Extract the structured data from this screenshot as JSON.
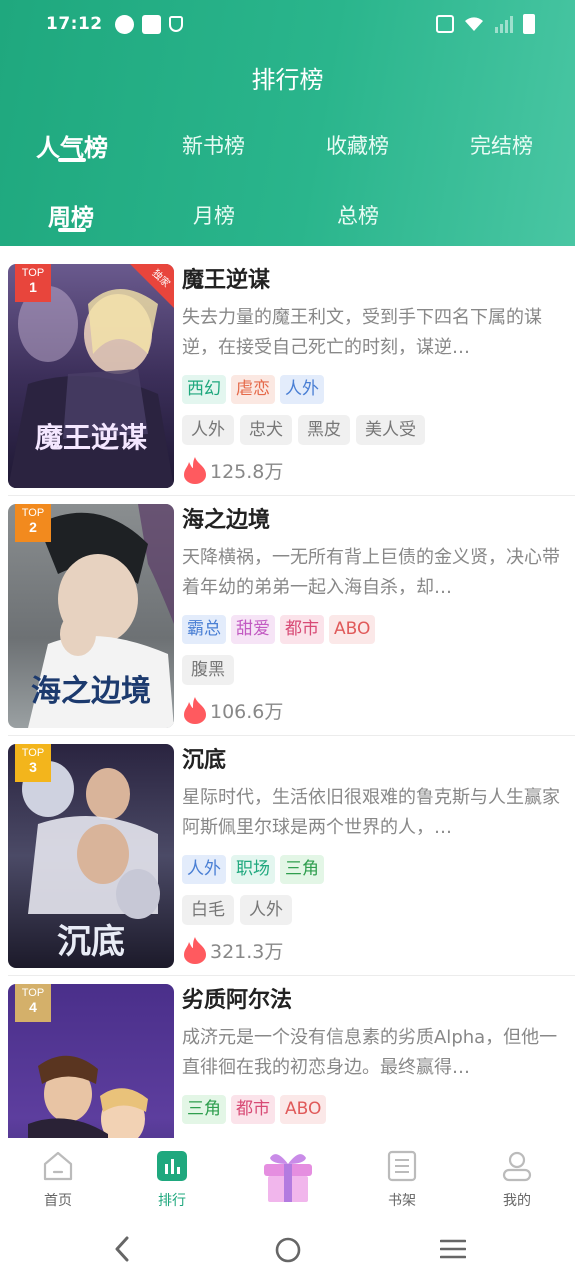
{
  "status_bar": {
    "time": "17:12"
  },
  "header": {
    "title": "排行榜",
    "tabs": [
      {
        "label": "人气榜",
        "active": true
      },
      {
        "label": "新书榜",
        "active": false
      },
      {
        "label": "收藏榜",
        "active": false
      },
      {
        "label": "完结榜",
        "active": false
      }
    ],
    "subtabs": [
      {
        "label": "周榜",
        "active": true
      },
      {
        "label": "月榜",
        "active": false
      },
      {
        "label": "总榜",
        "active": false
      }
    ]
  },
  "colors": {
    "accent": "#1fa87e",
    "heat": "#ff5a5f"
  },
  "items": [
    {
      "rank_top": "TOP",
      "rank_num": "1",
      "exclusive": "独家",
      "cover_text": "魔王逆谋",
      "name": "魔王逆谋",
      "desc": "失去力量的魔王利文，受到手下四名下属的谋逆，在接受自己死亡的时刻，谋逆…",
      "categories": [
        "西幻",
        "虐恋",
        "人外"
      ],
      "tags": [
        "人外",
        "忠犬",
        "黑皮",
        "美人受"
      ],
      "heat": "125.8万"
    },
    {
      "rank_top": "TOP",
      "rank_num": "2",
      "cover_text": "海之边境",
      "name": "海之边境",
      "desc": "天降横祸，一无所有背上巨债的金义贤，决心带着年幼的弟弟一起入海自杀，却…",
      "categories": [
        "霸总",
        "甜爱",
        "都市",
        "ABO"
      ],
      "tags": [
        "腹黑"
      ],
      "heat": "106.6万"
    },
    {
      "rank_top": "TOP",
      "rank_num": "3",
      "cover_text": "沉底",
      "name": "沉底",
      "desc": "星际时代，生活依旧很艰难的鲁克斯与人生赢家阿斯佩里尔球是两个世界的人，…",
      "categories": [
        "人外",
        "职场",
        "三角"
      ],
      "tags": [
        "白毛",
        "人外"
      ],
      "heat": "321.3万"
    },
    {
      "rank_top": "TOP",
      "rank_num": "4",
      "cover_text": "",
      "name": "劣质阿尔法",
      "desc": "成济元是一个没有信息素的劣质Alpha，但他一直徘徊在我的初恋身边。最终赢得…",
      "categories": [
        "三角",
        "都市",
        "ABO"
      ],
      "tags": [],
      "heat": ""
    }
  ],
  "bottom_nav": [
    {
      "label": "首页",
      "icon": "home-icon"
    },
    {
      "label": "排行",
      "icon": "ranking-icon"
    },
    {
      "label": "",
      "icon": "gift-icon"
    },
    {
      "label": "书架",
      "icon": "bookshelf-icon"
    },
    {
      "label": "我的",
      "icon": "profile-icon"
    }
  ]
}
